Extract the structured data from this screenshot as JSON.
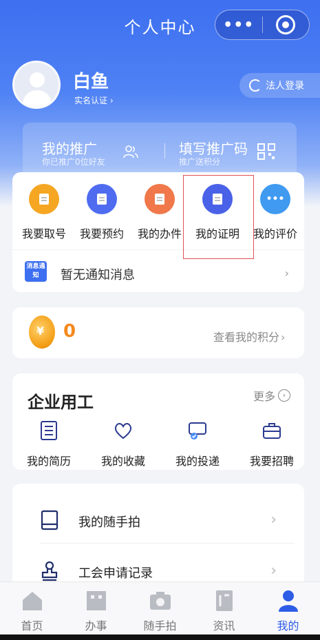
{
  "nav": {
    "title": "个人中心",
    "more_glyph": "•••"
  },
  "user": {
    "name": "白鱼",
    "verify_link": "实名认证 ›"
  },
  "corp_login": {
    "label": "法人登录"
  },
  "promo": {
    "left": {
      "title": "我的推广",
      "subtitle": "你已推广0位好友"
    },
    "right": {
      "title": "填写推广码",
      "subtitle": "推广送积分"
    }
  },
  "services": [
    {
      "label": "我要取号",
      "icon": "ticket-icon",
      "color": "#f5a623"
    },
    {
      "label": "我要预约",
      "icon": "calendar-icon",
      "color": "#4f6cf0"
    },
    {
      "label": "我的办件",
      "icon": "document-icon",
      "color": "#f0784a"
    },
    {
      "label": "我的证明",
      "icon": "certificate-icon",
      "color": "#4a62e8"
    },
    {
      "label": "我的评价",
      "icon": "comment-icon",
      "color": "#3f9af0"
    }
  ],
  "notice": {
    "badge": "消息通知",
    "text": "暂无通知消息",
    "arrow": "›"
  },
  "points": {
    "value": "0",
    "coin_symbol": "¥",
    "link": "查看我的积分",
    "arrow": "›"
  },
  "enterprise": {
    "title": "企业用工",
    "more": "更多",
    "items": [
      {
        "label": "我的简历",
        "icon": "resume-icon"
      },
      {
        "label": "我的收藏",
        "icon": "heart-icon"
      },
      {
        "label": "我的投递",
        "icon": "delivery-icon"
      },
      {
        "label": "我要招聘",
        "icon": "briefcase-icon"
      }
    ]
  },
  "list": [
    {
      "label": "我的随手拍",
      "icon": "tablet-icon",
      "arrow": "›"
    },
    {
      "label": "工会申请记录",
      "icon": "stamp-icon",
      "arrow": "›"
    }
  ],
  "tabs": [
    {
      "label": "首页",
      "icon": "home-icon",
      "active": false
    },
    {
      "label": "办事",
      "icon": "office-icon",
      "active": false
    },
    {
      "label": "随手拍",
      "icon": "camera-icon",
      "active": false
    },
    {
      "label": "资讯",
      "icon": "news-icon",
      "active": false
    },
    {
      "label": "我的",
      "icon": "profile-icon",
      "active": true
    }
  ],
  "colors": {
    "primary": "#3d6ff0",
    "accent_orange": "#f5891f",
    "active_tab": "#2e5ce6"
  }
}
